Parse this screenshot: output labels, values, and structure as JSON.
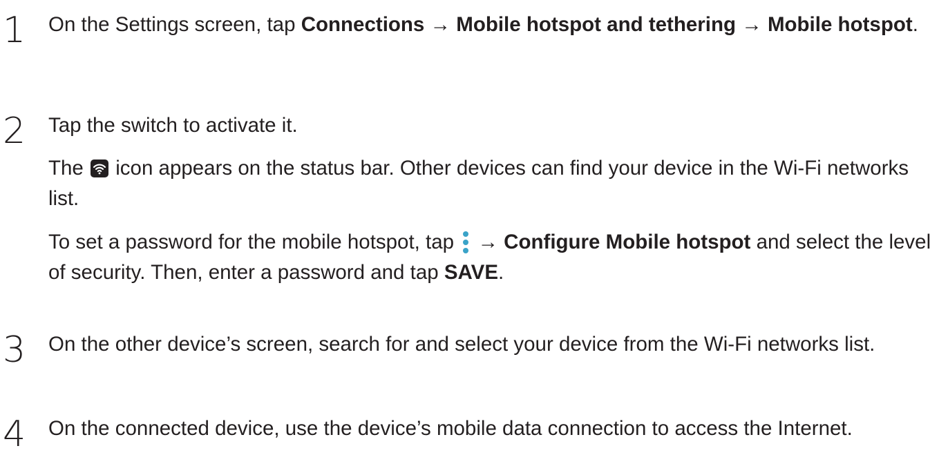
{
  "steps": [
    {
      "number": "1",
      "paragraphs": [
        {
          "t1": "On the Settings screen, tap ",
          "b1": "Connections",
          "t2": " → ",
          "b2": "Mobile hotspot and tethering",
          "t3": " → ",
          "b3": "Mobile hotspot",
          "t4": "."
        }
      ]
    },
    {
      "number": "2",
      "paragraphs": [
        {
          "text": "Tap the switch to activate it."
        },
        {
          "t1": "The ",
          "icon": "wifi-hotspot-icon",
          "t2": " icon appears on the status bar. Other devices can find your device in the Wi-Fi networks list."
        },
        {
          "t1": "To set a password for the mobile hotspot, tap ",
          "icon": "more-options-icon",
          "t2": " → ",
          "b1": "Configure Mobile hotspot",
          "t3": " and select the level of security. Then, enter a password and tap ",
          "b2": "SAVE",
          "t4": "."
        }
      ]
    },
    {
      "number": "3",
      "paragraphs": [
        {
          "text": "On the other device’s screen, search for and select your device from the Wi-Fi networks list."
        }
      ]
    },
    {
      "number": "4",
      "paragraphs": [
        {
          "text": "On the connected device, use the device’s mobile data connection to access the Internet."
        }
      ]
    }
  ],
  "colors": {
    "text": "#231f20",
    "accent": "#3aa3c8"
  }
}
